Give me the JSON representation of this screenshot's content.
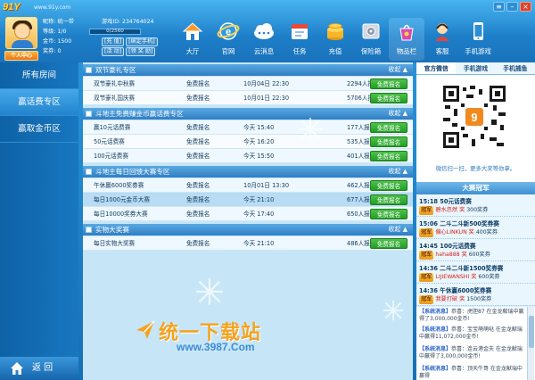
{
  "app": {
    "logo": "91Y",
    "url": "www.91y.com"
  },
  "user": {
    "nickname_label": "昵称:",
    "nickname": "统一带",
    "id_label": "游戏ID:",
    "id": "234764024",
    "level_label": "等级:",
    "level": "1/0",
    "exp": "0/2560",
    "gold_label": "金币:",
    "gold": "1500",
    "recharge": "[充 值]",
    "bind_phone": "[绑定手机]",
    "points_label": "奖券:",
    "points": "0",
    "activity": "[活 动]",
    "receive": "[领 奖 励]",
    "center_btn": "个人中心"
  },
  "nav": [
    {
      "label": "大厅",
      "icon": "home-icon"
    },
    {
      "label": "官网",
      "icon": "ie-globe-icon"
    },
    {
      "label": "云消息",
      "icon": "cloud-message-icon"
    },
    {
      "label": "任务",
      "icon": "calendar-task-icon"
    },
    {
      "label": "充值",
      "icon": "coins-icon"
    },
    {
      "label": "保险箱",
      "icon": "safe-icon"
    },
    {
      "label": "物品栏",
      "icon": "gift-bag-icon"
    },
    {
      "label": "客服",
      "icon": "customer-service-icon"
    },
    {
      "label": "手机游戏",
      "icon": "mobile-phone-icon"
    }
  ],
  "sidebar": {
    "items": [
      {
        "label": "所有房间"
      },
      {
        "label": "赢话费专区"
      },
      {
        "label": "赢取金币区"
      }
    ],
    "back": "返 回"
  },
  "sections": [
    {
      "title": "双节豪礼专区",
      "fold": "收起 ▲",
      "rows": [
        {
          "name": "双节豪礼中秋赛",
          "fee": "免费报名",
          "time": "10月04日 22:30",
          "count": "2294人报名",
          "btn": "免费报名"
        },
        {
          "name": "双节豪礼国庆赛",
          "fee": "免费报名",
          "time": "10月01日 22:30",
          "count": "5706人报名",
          "btn": "免费报名"
        }
      ]
    },
    {
      "title": "斗地主免费赚金币赢话费专区",
      "fold": "收起 ▲",
      "rows": [
        {
          "name": "赢10元话费赛",
          "fee": "免费报名",
          "time": "今天 15:40",
          "count": "177人报名",
          "btn": "免费报名"
        },
        {
          "name": "50元话费赛",
          "fee": "免费报名",
          "time": "今天 16:20",
          "count": "535人报名",
          "btn": "免费报名"
        },
        {
          "name": "100元话费赛",
          "fee": "免费报名",
          "time": "今天 15:50",
          "count": "401人报名",
          "btn": "免费报名"
        }
      ]
    },
    {
      "title": "斗地主每日回馈大赛专区",
      "fold": "收起 ▲",
      "rows": [
        {
          "name": "午休赢6000奖券赛",
          "fee": "免费报名",
          "time": "10月01日 13:30",
          "count": "462人报名",
          "btn": "免费报名"
        },
        {
          "name": "每日1000元金币大赛",
          "fee": "免费报名",
          "time": "今天 21:10",
          "count": "677人报名",
          "btn": "免费报名"
        },
        {
          "name": "每日10000奖券大赛",
          "fee": "免费报名",
          "time": "今天 17:40",
          "count": "650人报名",
          "btn": "免费报名"
        }
      ]
    },
    {
      "title": "实物大奖赛",
      "fold": "收起 ▲",
      "rows": [
        {
          "name": "每日实物大奖赛",
          "fee": "免费报名",
          "time": "今天 21:10",
          "count": "486人报名",
          "btn": "免费报名"
        }
      ]
    }
  ],
  "watermark": {
    "line1": "统一下载站",
    "line2": "www.3987.Com"
  },
  "right": {
    "tabs": [
      "官方微信",
      "手机游戏",
      "手机捕鱼"
    ],
    "qr_caption": "微信扫一扫，更多大奖等你拿。",
    "champ_title": "大赛冠军",
    "champions": [
      {
        "title": "15:18 50元话费赛",
        "badge": "冠军",
        "name": "碧水忽然",
        "sep": "奖",
        "prize": "300奖券"
      },
      {
        "title": "15:06 二斗二斗新500奖券赛",
        "badge": "冠军",
        "name": "偏心LINKUN",
        "sep": "奖",
        "prize": "400奖券"
      },
      {
        "title": "14:45 100元话费赛",
        "badge": "冠军",
        "name": "haha888",
        "sep": "奖",
        "prize": "600奖券"
      },
      {
        "title": "14:36 二斗二斗新1500奖券赛",
        "badge": "冠军",
        "name": "LIJIEWANSHI",
        "sep": "奖",
        "prize": "600奖券"
      },
      {
        "title": "14:36 午休赢6000奖券赛",
        "badge": "冠军",
        "name": "我要打破",
        "sep": "奖",
        "prize": "1500奖券"
      }
    ],
    "messages": [
      {
        "tag": "【系统消息】",
        "text": "恭喜：虎胆87 在金龙献瑞中赢得了3,000,000金币!"
      },
      {
        "tag": "【系统消息】",
        "text": "恭喜：宝宝萌萌哒 在金龙献瑞中赢得11,072,000金币!"
      },
      {
        "tag": "【系统消息】",
        "text": "恭喜：连云港金夫 在金龙献瑞中赢得了3,000,000金币!"
      },
      {
        "tag": "【系统消息】",
        "text": "恭喜：顶天牛哥 在金龙献瑞中赢得"
      }
    ]
  },
  "colors": {
    "accent": "#1d7ec8",
    "register_green": "#2ba52c",
    "champion_gold": "#e89616"
  }
}
